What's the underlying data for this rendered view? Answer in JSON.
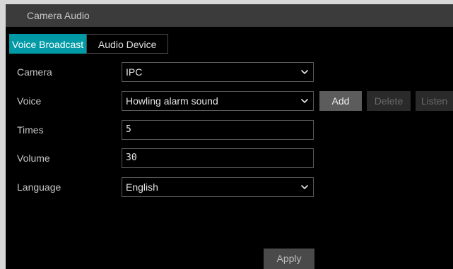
{
  "window": {
    "title": "Camera Audio"
  },
  "tabs": [
    {
      "label": "Voice Broadcast",
      "active": true
    },
    {
      "label": "Audio Device",
      "active": false
    }
  ],
  "form": {
    "camera": {
      "label": "Camera",
      "value": "IPC"
    },
    "voice": {
      "label": "Voice",
      "value": "Howling alarm sound"
    },
    "times": {
      "label": "Times",
      "value": "5"
    },
    "volume": {
      "label": "Volume",
      "value": "30"
    },
    "language": {
      "label": "Language",
      "value": "English"
    }
  },
  "buttons": {
    "add": "Add",
    "delete": "Delete",
    "listen": "Listen",
    "apply": "Apply"
  },
  "colors": {
    "accent": "#009aa6",
    "titlebar": "#3b3b3b",
    "background": "#000000"
  },
  "icons": {
    "dropdown": "chevron-down-icon"
  }
}
